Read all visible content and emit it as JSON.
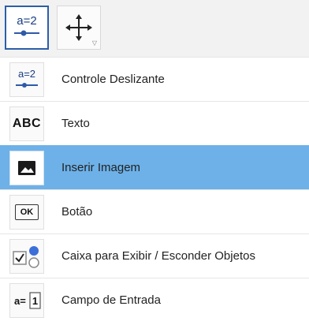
{
  "toolbar": {
    "selected_tool_icon_text": "a=2",
    "selected_tool_icon": "slider-icon",
    "move_tool_icon": "move-graphics-view-icon"
  },
  "menu": {
    "items": [
      {
        "label": "Controle Deslizante",
        "icon": "slider-icon",
        "icon_text": "a=2",
        "active": false
      },
      {
        "label": "Texto",
        "icon": "text-icon",
        "icon_text": "ABC",
        "active": false
      },
      {
        "label": "Inserir Imagem",
        "icon": "image-icon",
        "icon_text": "",
        "active": true
      },
      {
        "label": "Botão",
        "icon": "button-icon",
        "icon_text": "OK",
        "active": false
      },
      {
        "label": "Caixa para Exibir / Esconder Objetos",
        "icon": "checkbox-icon",
        "icon_text": "",
        "active": false
      },
      {
        "label": "Campo de Entrada",
        "icon": "input-box-icon",
        "icon_text": "a=1",
        "active": false
      }
    ]
  },
  "colors": {
    "active_row": "#6db1e8",
    "selected_border": "#2b5fa8",
    "slider_blue": "#2f5aa8"
  }
}
